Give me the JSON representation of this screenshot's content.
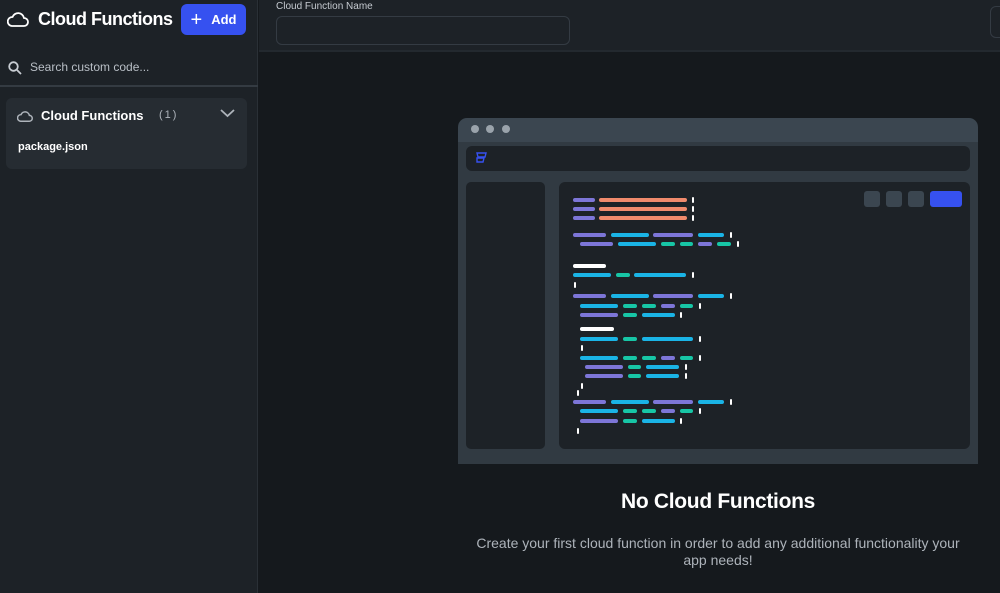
{
  "sidebar": {
    "title": "Cloud Functions",
    "add_label": "Add",
    "search_placeholder": "Search custom code...",
    "group": {
      "title": "Cloud Functions",
      "count": "(1)",
      "files": [
        "package.json"
      ]
    }
  },
  "topbar": {
    "field_label": "Cloud Function Name",
    "field_value": ""
  },
  "empty_state": {
    "title": "No Cloud Functions",
    "description": "Create your first cloud function in order to add any additional functionality your app needs!"
  },
  "colors": {
    "accent": "#3651f0",
    "purple": "#7d76d8",
    "orange": "#f08a6c",
    "cyan": "#1ab4e6",
    "teal": "#17c6a6"
  }
}
